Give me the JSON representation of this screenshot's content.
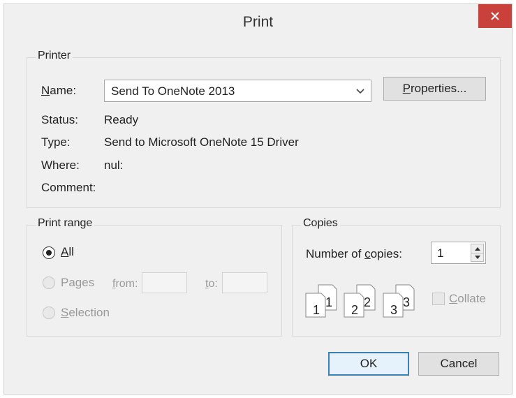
{
  "window": {
    "title": "Print"
  },
  "printer": {
    "group_label": "Printer",
    "name_label_u": "N",
    "name_label_rest": "ame:",
    "name_value": "Send To OneNote 2013",
    "properties_u": "P",
    "properties_rest": "roperties...",
    "status_label": "Status:",
    "status_value": "Ready",
    "type_label": "Type:",
    "type_value": "Send to Microsoft OneNote 15 Driver",
    "where_label": "Where:",
    "where_value": "nul:",
    "comment_label": "Comment:"
  },
  "print_range": {
    "group_label": "Print range",
    "all_u": "A",
    "all_rest": "ll",
    "pages_label": "Pages",
    "from_u": "f",
    "from_rest": "rom:",
    "to_u": "t",
    "to_rest": "o:",
    "selection_u": "S",
    "selection_rest": "election",
    "selected": "All"
  },
  "copies": {
    "group_label": "Copies",
    "number_label_a": "Number of ",
    "number_label_u": "c",
    "number_label_b": "opies:",
    "number_value": "1",
    "collate_u": "C",
    "collate_rest": "ollate",
    "collate_checked": false,
    "page_pairs": [
      {
        "front": "1",
        "back": "1"
      },
      {
        "front": "2",
        "back": "2"
      },
      {
        "front": "3",
        "back": "3"
      }
    ]
  },
  "actions": {
    "ok_label": "OK",
    "cancel_label": "Cancel"
  }
}
